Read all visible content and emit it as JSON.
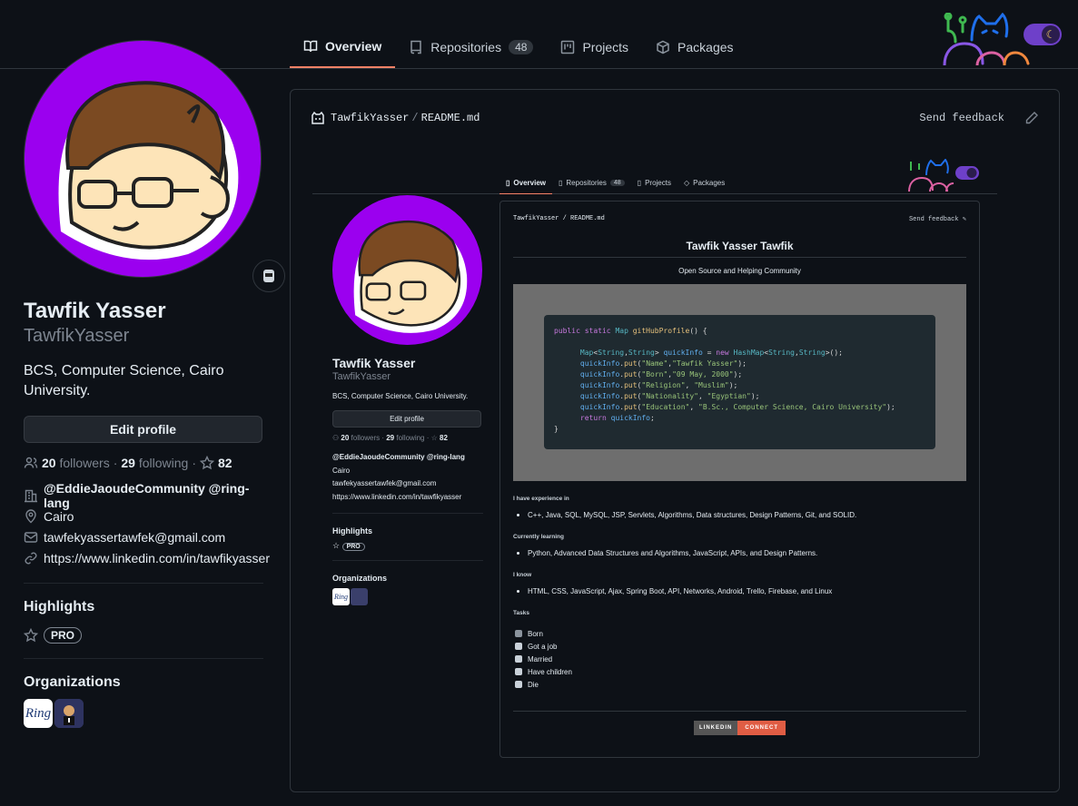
{
  "nav": {
    "tabs": [
      {
        "label": "Overview",
        "icon": "book-icon"
      },
      {
        "label": "Repositories",
        "icon": "repo-icon",
        "count": "48"
      },
      {
        "label": "Projects",
        "icon": "project-icon"
      },
      {
        "label": "Packages",
        "icon": "package-icon"
      }
    ]
  },
  "profile": {
    "name": "Tawfik Yasser",
    "login": "TawfikYasser",
    "bio": "BCS, Computer Science, Cairo University.",
    "edit_label": "Edit profile",
    "followers_count": "20",
    "followers_label": "followers",
    "following_count": "29",
    "following_label": "following",
    "stars_count": "82",
    "organization": "@EddieJaoudeCommunity @ring-lang",
    "location": "Cairo",
    "email": "tawfekyassertawfek@gmail.com",
    "website": "https://www.linkedin.com/in/tawfikyasser"
  },
  "highlights": {
    "title": "Highlights",
    "badge": "PRO"
  },
  "organizations": {
    "title": "Organizations",
    "ring_text": "Ring"
  },
  "readme": {
    "owner": "TawfikYasser",
    "slash": "/",
    "file": "README.md",
    "feedback": "Send feedback"
  },
  "embedded": {
    "title": "Tawfik Yasser Tawfik",
    "subtitle": "Open Source and Helping Community",
    "code": [
      "public static Map gitHubProfile() {",
      "",
      "      Map<String,String> quickInfo = new HashMap<String,String>();",
      "      quickInfo.put(\"Name\",\"Tawfik Yasser\");",
      "      quickInfo.put(\"Born\",\"09 May, 2000\");",
      "      quickInfo.put(\"Religion\", \"Muslim\");",
      "      quickInfo.put(\"Nationality\", \"Egyptian\");",
      "      quickInfo.put(\"Education\", \"B.Sc., Computer Science, Cairo University\");",
      "      return quickInfo;",
      "}"
    ],
    "sections": [
      {
        "heading": "I have experience in",
        "item": "C++, Java, SQL, MySQL, JSP, Servlets, Algorithms, Data structures, Design Patterns, Git, and SOLID."
      },
      {
        "heading": "Currently learning",
        "item": "Python, Advanced Data Structures and Algorithms, JavaScript, APIs, and Design Patterns."
      },
      {
        "heading": "I know",
        "item": "HTML, CSS, JavaScript, Ajax, Spring Boot, API, Networks, Android, Trello, Firebase, and Linux"
      }
    ],
    "tasks_heading": "Tasks",
    "tasks": [
      "Born",
      "Got a job",
      "Married",
      "Have children",
      "Die"
    ],
    "badge_left": "LINKEDIN",
    "badge_right": "CONNECT"
  }
}
